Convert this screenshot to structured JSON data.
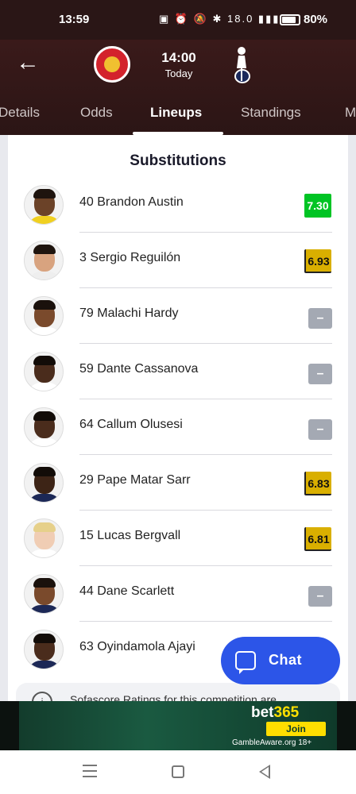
{
  "status_bar": {
    "time": "13:59",
    "icons": [
      "nfc-icon",
      "alarm-icon",
      "mute-icon",
      "bluetooth-icon",
      "data-speed",
      "signal-icon",
      "battery-icon"
    ],
    "data_speed": "18.0",
    "battery": "80%"
  },
  "match": {
    "kickoff_time": "14:00",
    "kickoff_day": "Today",
    "home_badge": "brentford-badge",
    "away_badge": "tottenham-badge"
  },
  "tabs": [
    "Details",
    "Odds",
    "Lineups",
    "Standings",
    "M"
  ],
  "active_tab": "Lineups",
  "section_title": "Substitutions",
  "substitutions": [
    {
      "name": "40 Brandon Austin",
      "rating": "7.30",
      "rating_color": "#00c424"
    },
    {
      "name": "3 Sergio Reguilón",
      "rating": "6.93",
      "rating_color": "#d9af00"
    },
    {
      "name": "79 Malachi Hardy",
      "rating": "–",
      "rating_color": "#a4a9b3"
    },
    {
      "name": "59 Dante Cassanova",
      "rating": "–",
      "rating_color": "#a4a9b3"
    },
    {
      "name": "64 Callum Olusesi",
      "rating": "–",
      "rating_color": "#a4a9b3"
    },
    {
      "name": "29 Pape Matar Sarr",
      "rating": "6.83",
      "rating_color": "#d9af00"
    },
    {
      "name": "15 Lucas Bergvall",
      "rating": "6.81",
      "rating_color": "#d9af00"
    },
    {
      "name": "44 Dane Scarlett",
      "rating": "–",
      "rating_color": "#a4a9b3"
    },
    {
      "name": "63 Oyindamola Ajayi",
      "rating": "–",
      "rating_color": "#a4a9b3"
    }
  ],
  "info_note": "Sofascore Ratings for this competition are",
  "chat_button": "Chat",
  "ad": {
    "brand_part1": "bet",
    "brand_part2": "365",
    "join": "Join",
    "note": "GambleAware.org  18+"
  },
  "nav": [
    "menu-icon",
    "home-icon",
    "back-icon"
  ]
}
